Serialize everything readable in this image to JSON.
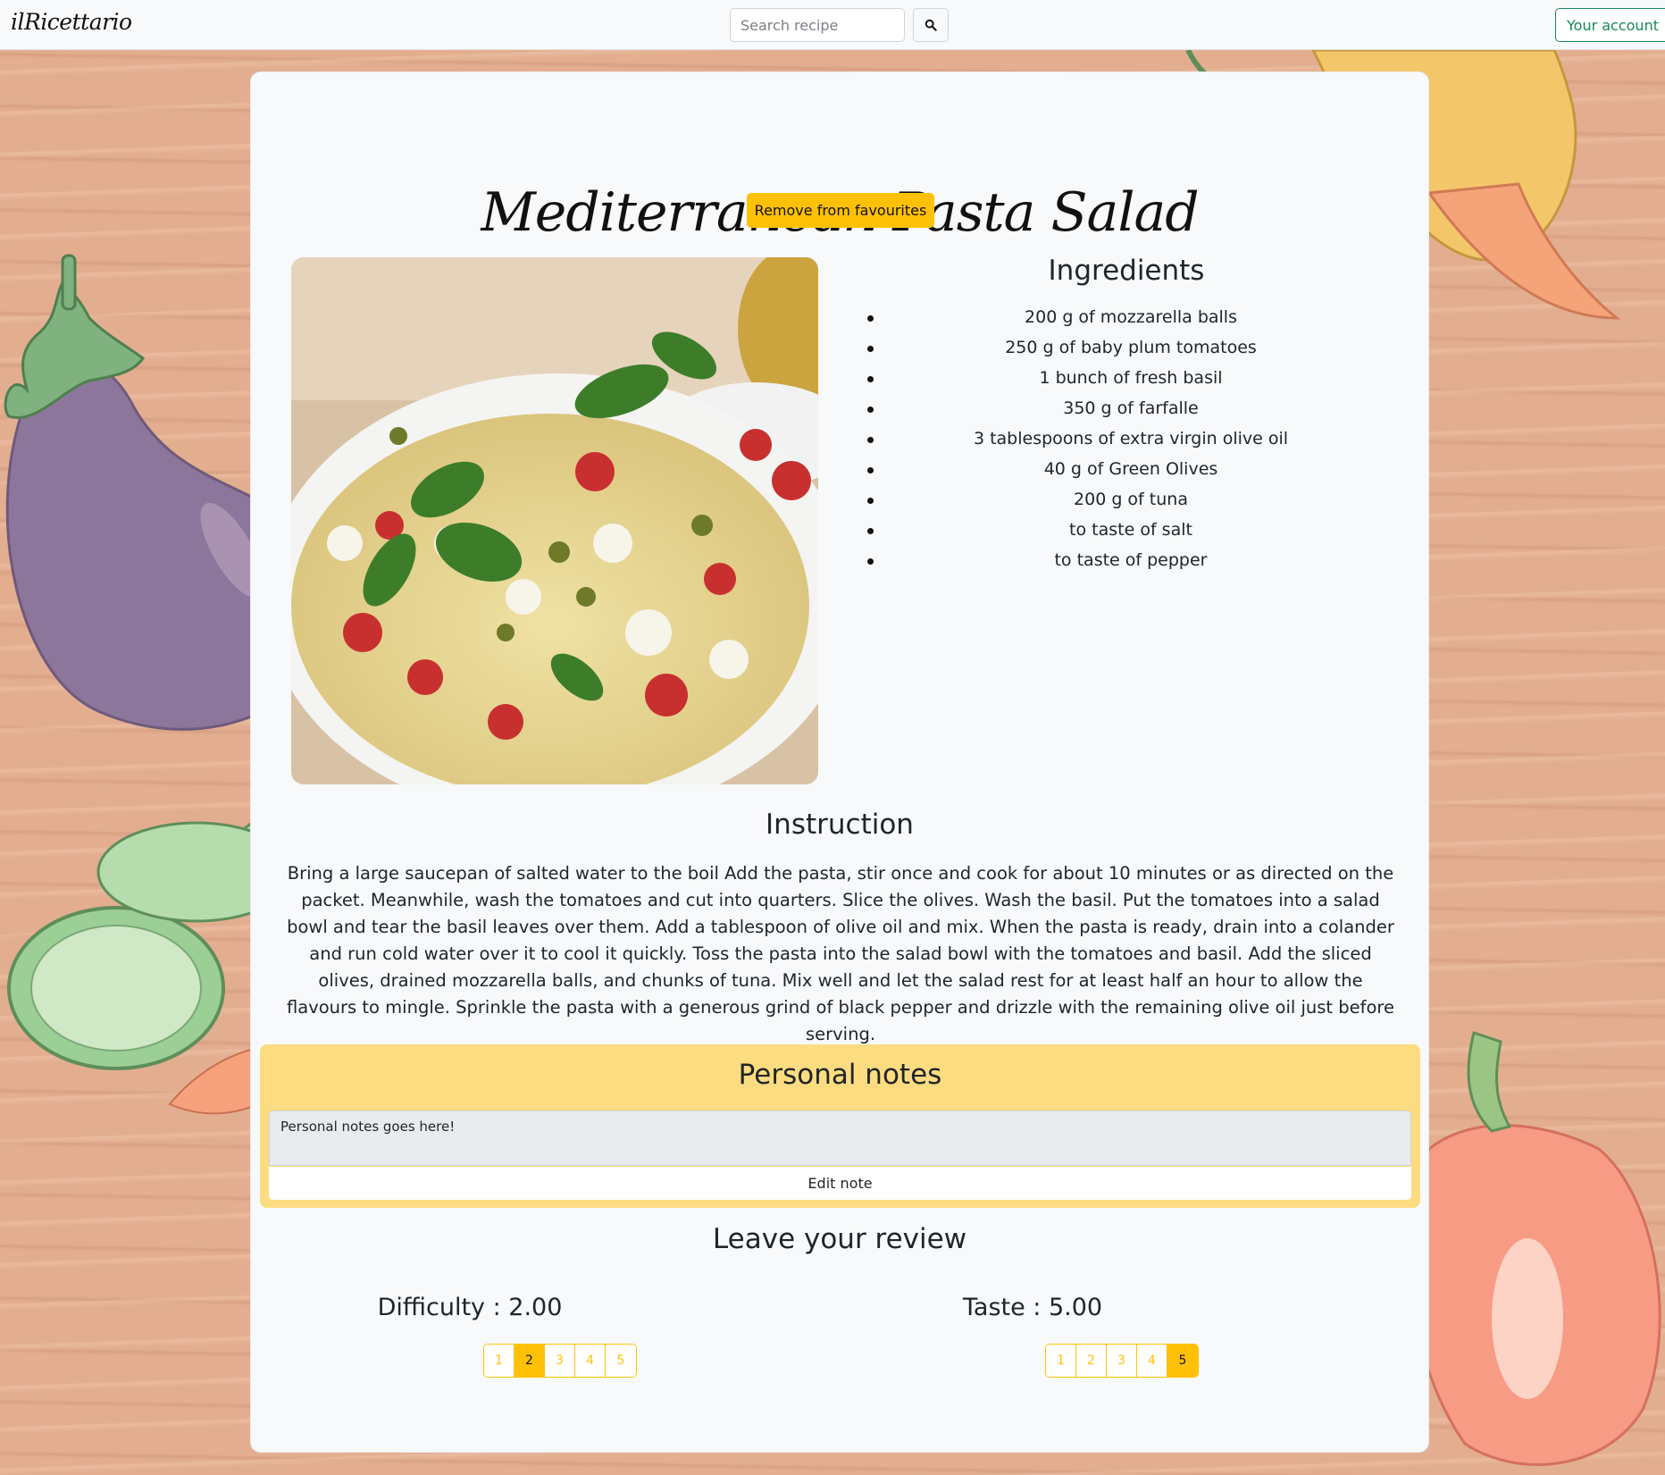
{
  "navbar": {
    "brand": "ilRicettario",
    "search_placeholder": "Search recipe",
    "account_label": "Your account"
  },
  "recipe": {
    "title": "Mediterranean Pasta Salad",
    "favourite_button": "Remove from favourites",
    "image_alt": "pasta-salad-photo",
    "ingredients_title": "Ingredients",
    "ingredients": [
      "200 g of mozzarella balls",
      "250 g of baby plum tomatoes",
      "1 bunch of fresh basil",
      "350 g of farfalle",
      "3 tablespoons of extra virgin olive oil",
      "40 g of Green Olives",
      "200 g of tuna",
      "to taste of salt",
      "to taste of pepper"
    ],
    "instruction_title": "Instruction",
    "instruction_text": "Bring a large saucepan of salted water to the boil Add the pasta, stir once and cook for about 10 minutes or as directed on the packet. Meanwhile, wash the tomatoes and cut into quarters. Slice the olives. Wash the basil. Put the tomatoes into a salad bowl and tear the basil leaves over them. Add a tablespoon of olive oil and mix. When the pasta is ready, drain into a colander and run cold water over it to cool it quickly. Toss the pasta into the salad bowl with the tomatoes and basil. Add the sliced olives, drained mozzarella balls, and chunks of tuna. Mix well and let the salad rest for at least half an hour to allow the flavours to mingle. Sprinkle the pasta with a generous grind of black pepper and drizzle with the remaining olive oil just before serving."
  },
  "notes": {
    "title": "Personal notes",
    "value": "Personal notes goes here!",
    "edit_button": "Edit note"
  },
  "review": {
    "title": "Leave your review",
    "difficulty": {
      "label": "Difficulty : 2.00",
      "selected": 2,
      "pages": [
        "1",
        "2",
        "3",
        "4",
        "5"
      ]
    },
    "taste": {
      "label": "Taste : 5.00",
      "selected": 5,
      "pages": [
        "1",
        "2",
        "3",
        "4",
        "5"
      ]
    }
  },
  "colors": {
    "accent": "#ffc107",
    "notes_panel": "#fcdc80",
    "success": "#198754",
    "card_bg": "#f8f9fa",
    "wood": "#e3ae90"
  },
  "icons": {
    "search": "search-icon"
  }
}
